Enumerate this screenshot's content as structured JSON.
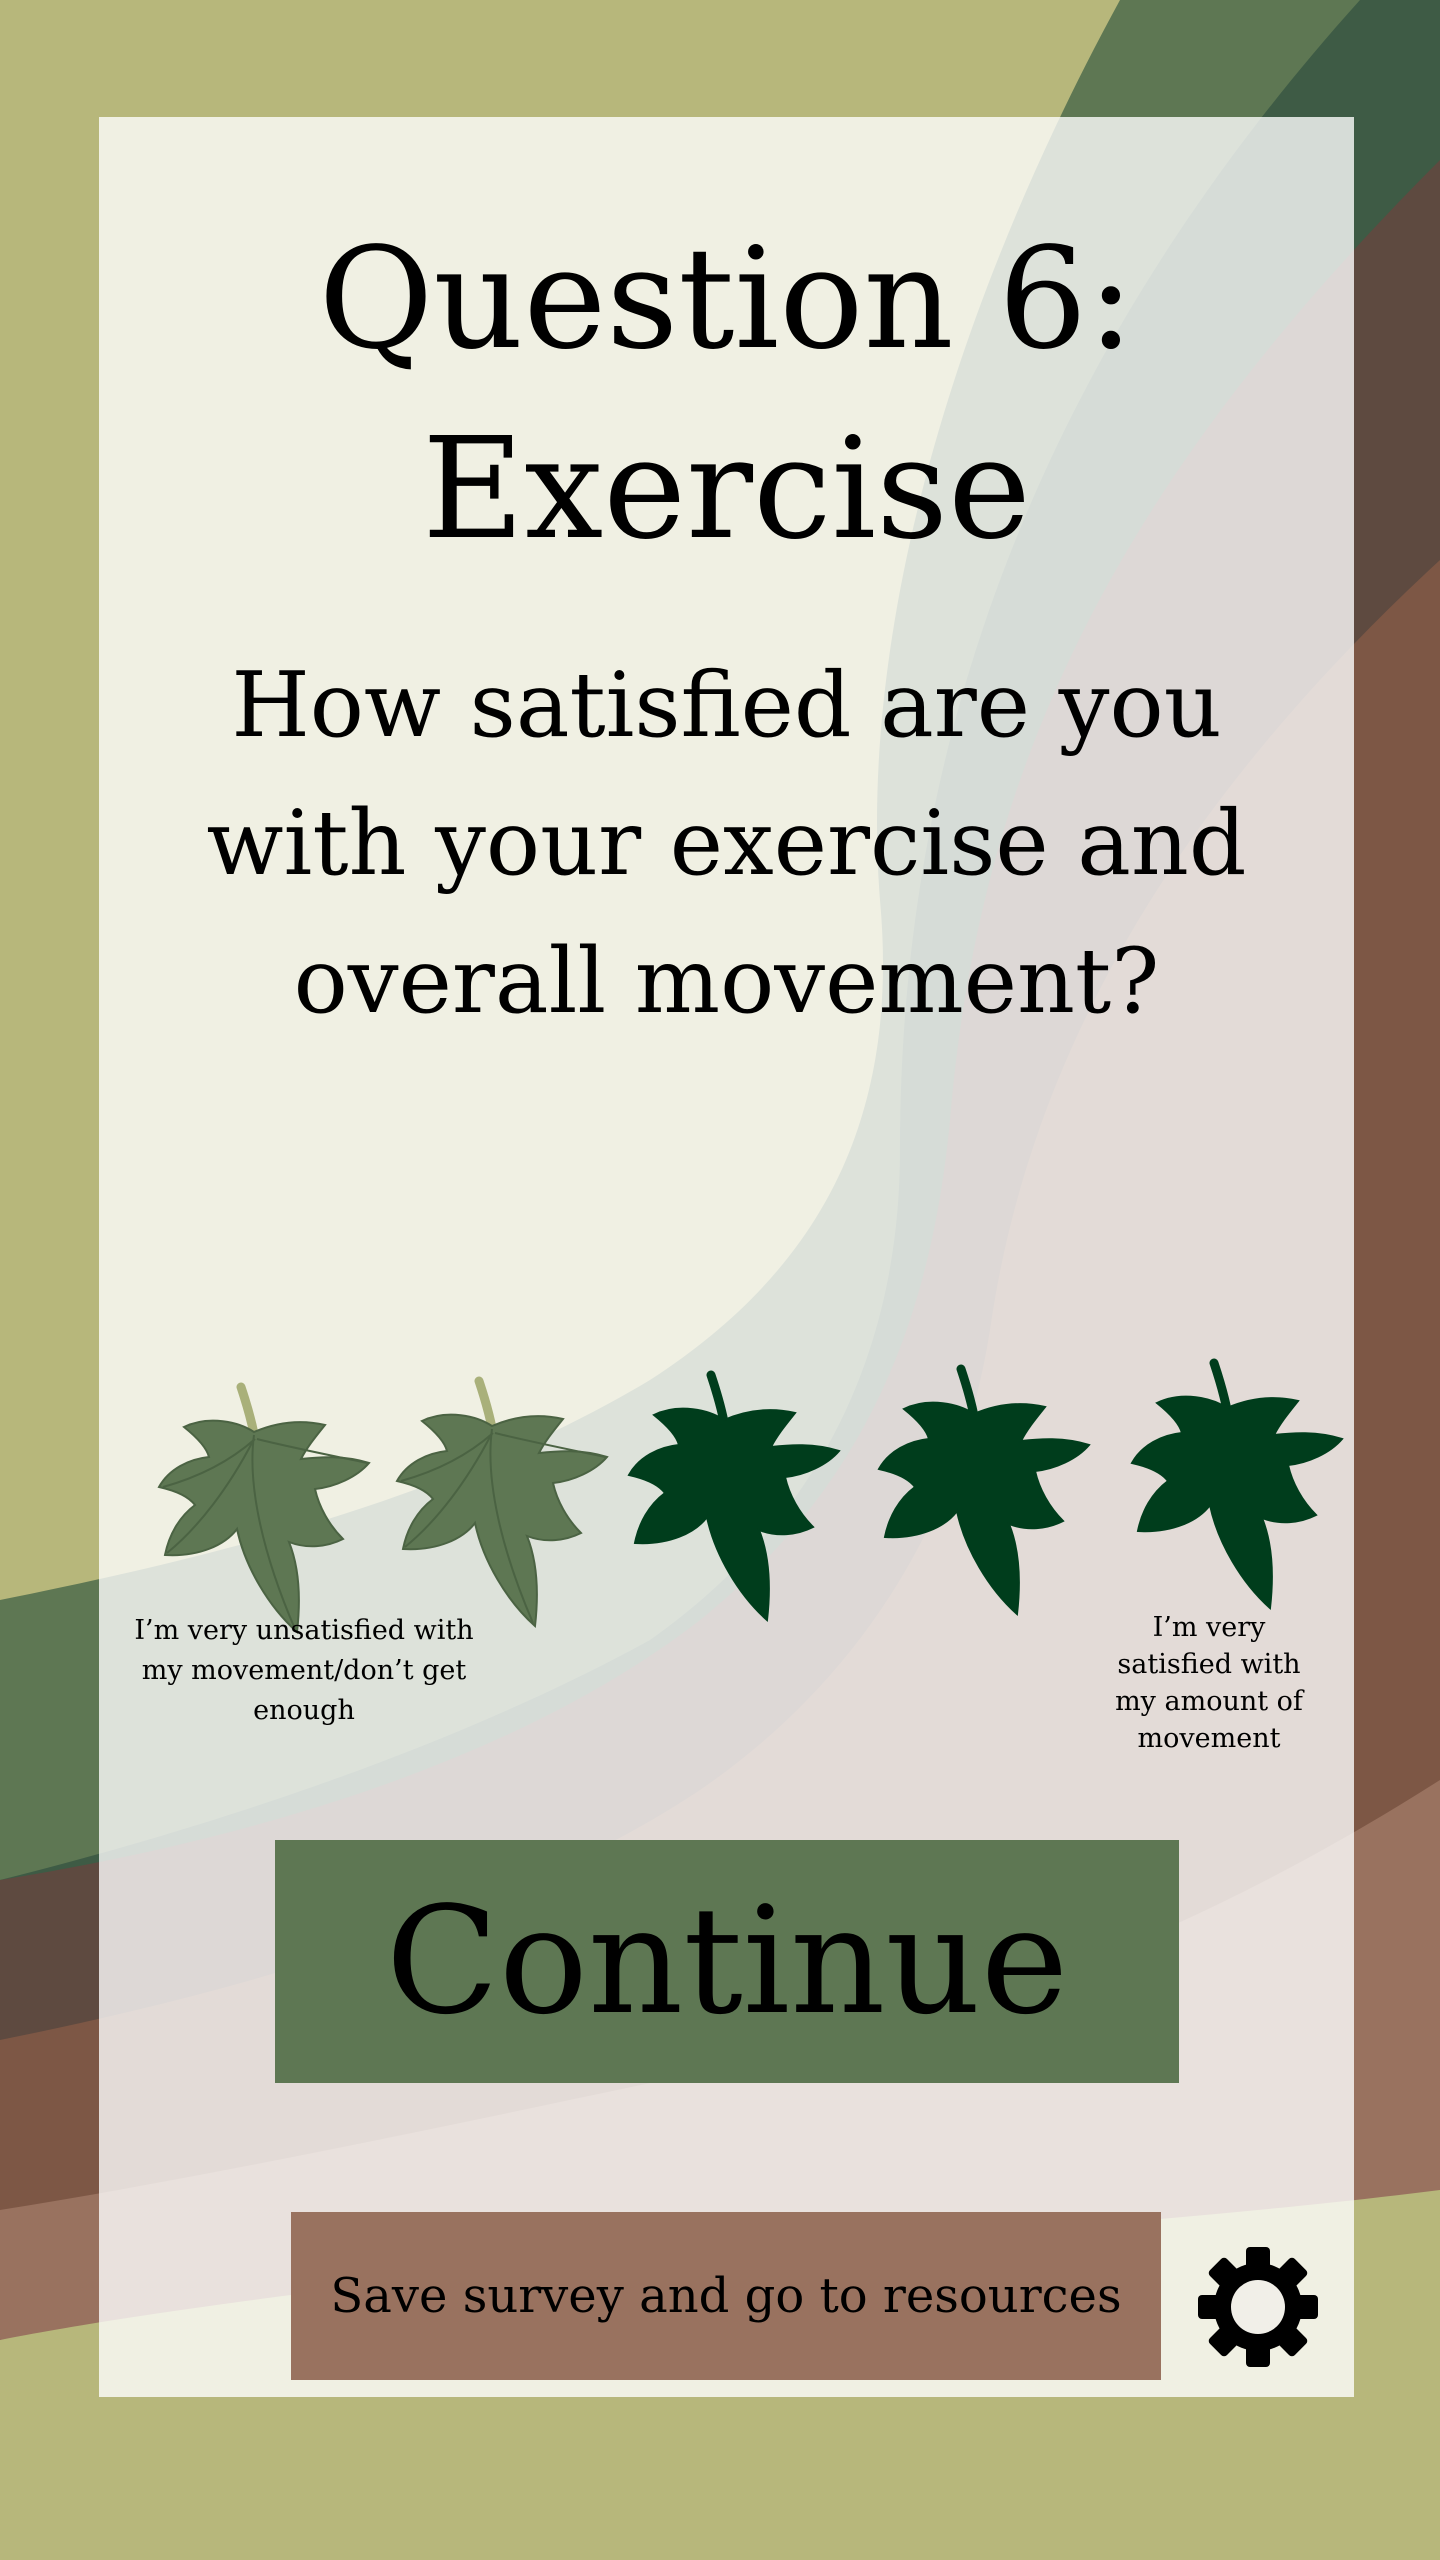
{
  "theme": {
    "background": "#b7b77b",
    "card": "#ffffff",
    "continue_button": "#5e7753",
    "save_button": "#99725f",
    "leaf_unselected": "#5e7753",
    "leaf_selected": "#003d1c"
  },
  "question": {
    "title_line1": "Question 6:",
    "title_line2": "Exercise",
    "text_line1": "How satisfied are you",
    "text_line2": "with your exercise and",
    "text_line3": "overall movement?"
  },
  "rating": {
    "max": 5,
    "selected": 2,
    "icon": "maple-leaf-icon",
    "low_label_line1": "I’m very unsatisfied with",
    "low_label_line2": "my movement/don’t get",
    "low_label_line3": "enough",
    "high_label_line1": "I’m very",
    "high_label_line2": "satisfied with",
    "high_label_line3": "my amount of",
    "high_label_line4": "movement"
  },
  "actions": {
    "continue_label": "Continue",
    "save_label": "Save survey and go to resources",
    "settings_icon": "gear-icon"
  }
}
